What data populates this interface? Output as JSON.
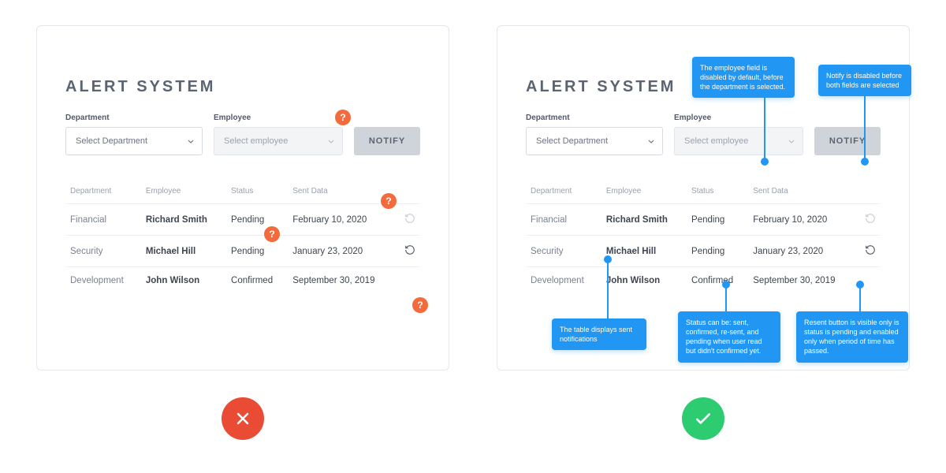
{
  "title": "ALERT SYSTEM",
  "filters": {
    "department_label": "Department",
    "department_placeholder": "Select Department",
    "employee_label": "Employee",
    "employee_placeholder": "Select employee",
    "notify_button": "NOTIFY"
  },
  "table": {
    "headers": {
      "department": "Department",
      "employee": "Employee",
      "status": "Status",
      "sent": "Sent Data"
    },
    "rows": [
      {
        "department": "Financial",
        "employee": "Richard Smith",
        "status": "Pending",
        "sent": "February 10, 2020",
        "resend": true
      },
      {
        "department": "Security",
        "employee": "Michael Hill",
        "status": "Pending",
        "sent": "January 23, 2020",
        "resend": true
      },
      {
        "department": "Development",
        "employee": "John Wilson",
        "status": "Confirmed",
        "sent": "September 30, 2019",
        "resend": false
      }
    ]
  },
  "question_mark": "?",
  "tips": {
    "employee_disabled": "The employee field is disabled by default, before the department is selected.",
    "notify_disabled": "Notify is disabled before both fields are selected",
    "table_purpose": "The table displays sent notifications",
    "status_values": "Status can be: sent, confirmed, re-sent, and pending when user read but didn't confirmed yet.",
    "resend_rule": "Resent button is visible only is status is pending and enabled only when period of time has passed."
  },
  "colors": {
    "badge_orange": "#f36a3d",
    "tip_blue": "#2196f3",
    "bad_red": "#e94b35",
    "good_green": "#2ecc71"
  }
}
